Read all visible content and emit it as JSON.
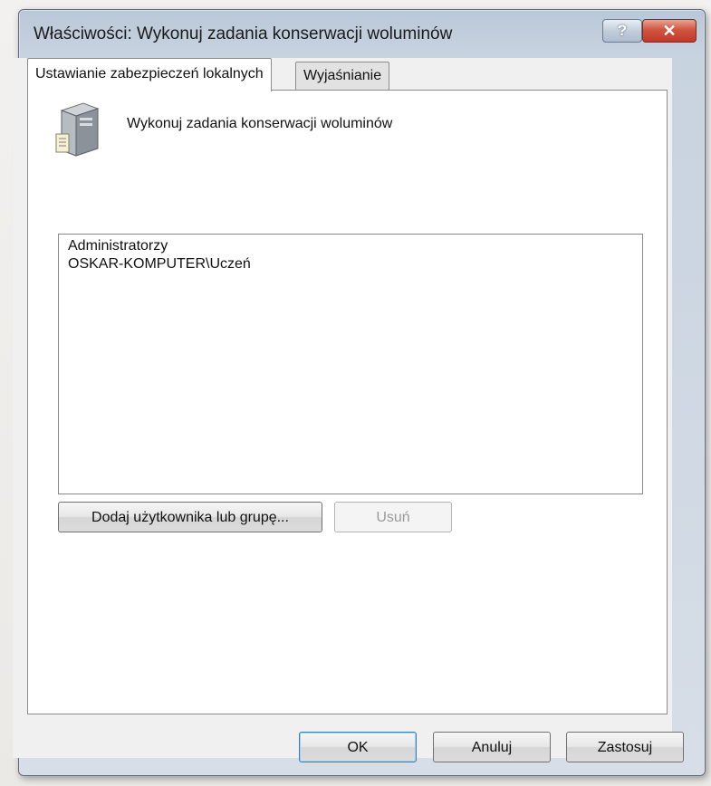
{
  "window": {
    "title": "Właściwości: Wykonuj zadania konserwacji woluminów",
    "help_label": "?",
    "close_label": "✕"
  },
  "tabs": [
    {
      "label": "Ustawianie zabezpieczeń lokalnych",
      "active": true
    },
    {
      "label": "Wyjaśnianie",
      "active": false
    }
  ],
  "policy": {
    "icon": "server-policy-icon",
    "name": "Wykonuj zadania konserwacji woluminów"
  },
  "accounts": [
    "Administratorzy",
    "OSKAR-KOMPUTER\\Uczeń"
  ],
  "actions": {
    "add_label": "Dodaj użytkownika lub grupę...",
    "remove_label": "Usuń"
  },
  "footer": {
    "ok_label": "OK",
    "cancel_label": "Anuluj",
    "apply_label": "Zastosuj"
  }
}
